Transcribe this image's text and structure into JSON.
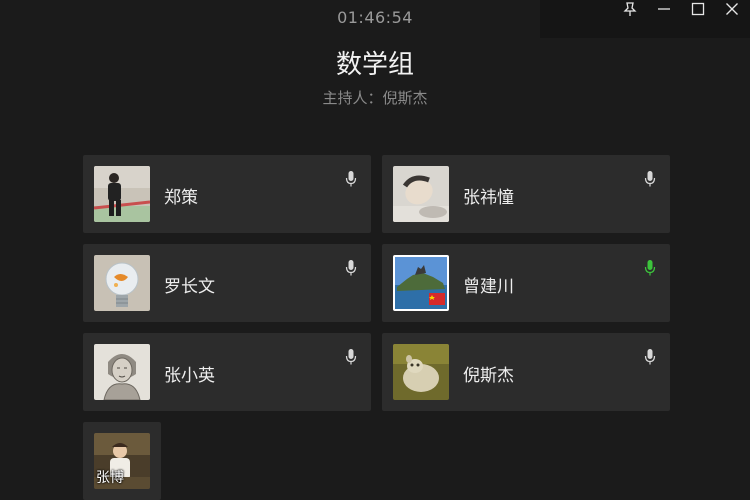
{
  "header": {
    "timer": "01:46:54",
    "title": "数学组",
    "host_line": "主持人：倪斯杰"
  },
  "window_controls": {
    "pin": "pin-icon",
    "minimize": "minimize-icon",
    "maximize": "maximize-icon",
    "close": "close-icon"
  },
  "participants": [
    {
      "name": "郑策",
      "mic": "mic-icon",
      "mic_active": false
    },
    {
      "name": "张祎憧",
      "mic": "mic-icon",
      "mic_active": false
    },
    {
      "name": "罗长文",
      "mic": "mic-icon",
      "mic_active": false
    },
    {
      "name": "曾建川",
      "mic": "mic-icon",
      "mic_active": true
    },
    {
      "name": "张小英",
      "mic": "mic-icon",
      "mic_active": false
    },
    {
      "name": "倪斯杰",
      "mic": "mic-icon",
      "mic_active": false
    }
  ],
  "extra_participant": {
    "name": "张博"
  },
  "colors": {
    "background": "#1b1b1b",
    "card": "#2c2c2c",
    "mic_idle": "#d8d8d8",
    "mic_active": "#3cc43c"
  }
}
